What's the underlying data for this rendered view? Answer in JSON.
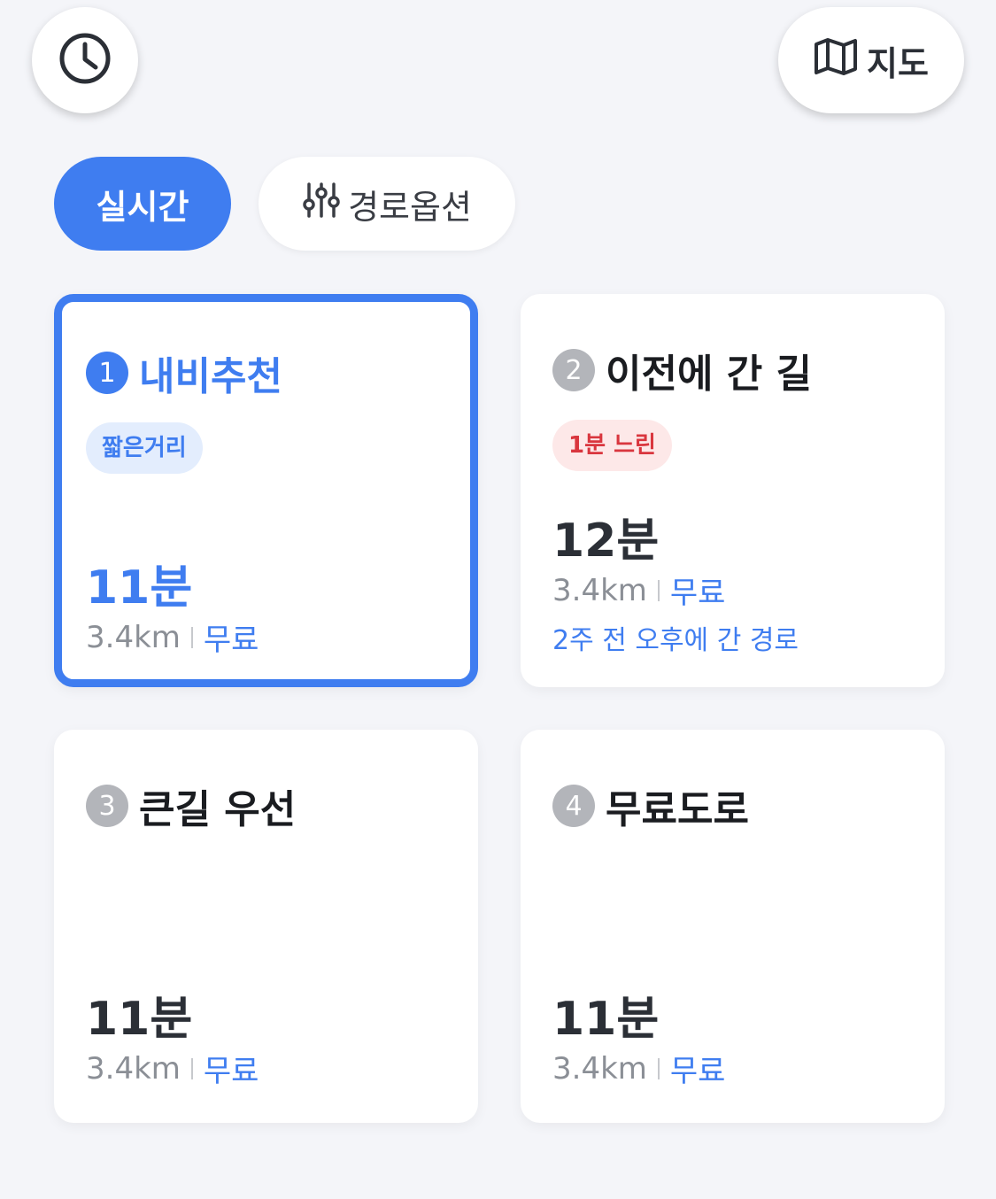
{
  "header": {
    "history_icon": "clock-icon",
    "map_button": {
      "icon": "map-icon",
      "label": "지도"
    }
  },
  "filters": {
    "realtime_label": "실시간",
    "options": {
      "icon": "sliders-icon",
      "label": "경로옵션"
    }
  },
  "colors": {
    "accent": "#3f7df0",
    "badge_blue_bg": "#e3edfd",
    "badge_red_bg": "#fde8e8",
    "badge_red_text": "#d9363e",
    "background": "#f4f5f9"
  },
  "routes": [
    {
      "number": "1",
      "title": "내비추천",
      "badge": "짧은거리",
      "time": "11분",
      "distance": "3.4km",
      "fee": "무료",
      "selected": true
    },
    {
      "number": "2",
      "title": "이전에 간 길",
      "badge": "1분 느린",
      "time": "12분",
      "distance": "3.4km",
      "fee": "무료",
      "note": "2주 전 오후에 간 경로",
      "selected": false
    },
    {
      "number": "3",
      "title": "큰길 우선",
      "time": "11분",
      "distance": "3.4km",
      "fee": "무료",
      "selected": false
    },
    {
      "number": "4",
      "title": "무료도로",
      "time": "11분",
      "distance": "3.4km",
      "fee": "무료",
      "selected": false
    }
  ]
}
